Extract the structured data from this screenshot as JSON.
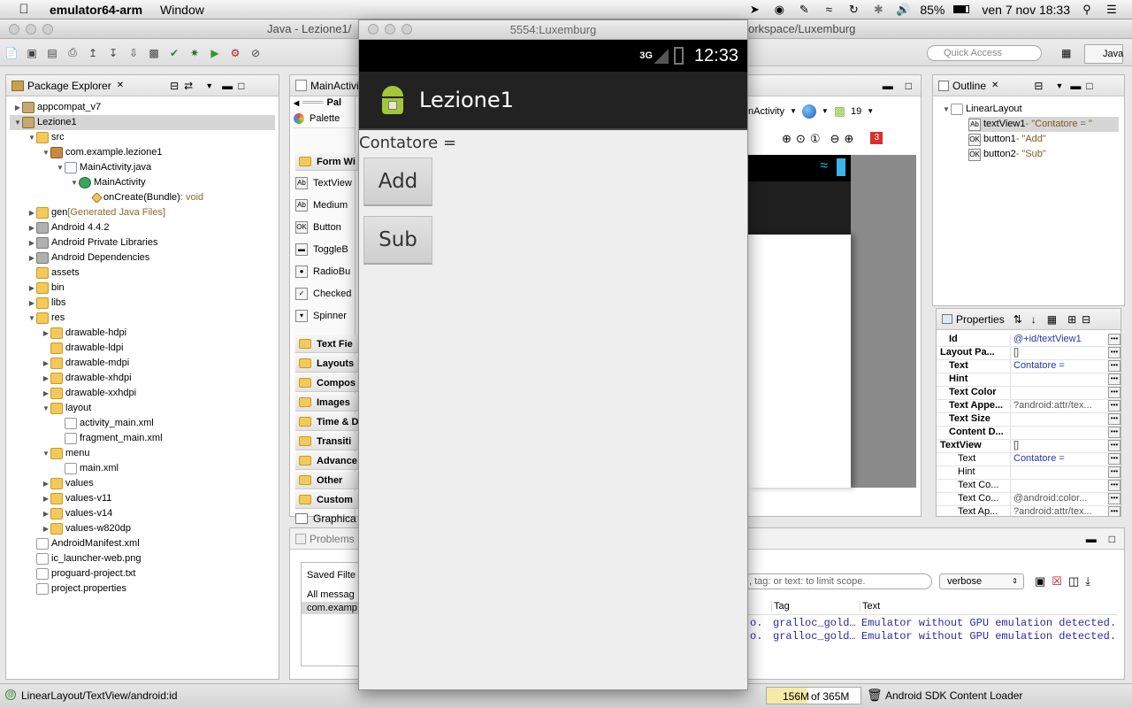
{
  "menubar": {
    "app_name": "emulator64-arm",
    "window_menu": "Window",
    "battery": "85%",
    "datetime": "ven 7 nov  18:33"
  },
  "eclipse": {
    "title": "Java - Lezione1/",
    "title_right": "orkspace/Luxemburg",
    "quick_access_placeholder": "Quick Access",
    "perspective": "Java",
    "status_path": "LinearLayout/TextView/android:id",
    "heap_used": "156M",
    "heap_total": "of 365M",
    "loader": "Android SDK Content Loader"
  },
  "package_explorer": {
    "tab": "Package Explorer",
    "rows": [
      {
        "label": "appcompat_v7",
        "suffix": ""
      },
      {
        "label": "Lezione1",
        "suffix": ""
      },
      {
        "label": "src",
        "suffix": ""
      },
      {
        "label": "com.example.lezione1",
        "suffix": ""
      },
      {
        "label": "MainActivity.java",
        "suffix": ""
      },
      {
        "label": "MainActivity",
        "suffix": ""
      },
      {
        "label": "onCreate(Bundle)",
        "suffix": " : void"
      },
      {
        "label": "gen",
        "suffix": " [Generated Java Files]"
      },
      {
        "label": "Android 4.4.2",
        "suffix": ""
      },
      {
        "label": "Android Private Libraries",
        "suffix": ""
      },
      {
        "label": "Android Dependencies",
        "suffix": ""
      },
      {
        "label": "assets",
        "suffix": ""
      },
      {
        "label": "bin",
        "suffix": ""
      },
      {
        "label": "libs",
        "suffix": ""
      },
      {
        "label": "res",
        "suffix": ""
      },
      {
        "label": "drawable-hdpi",
        "suffix": ""
      },
      {
        "label": "drawable-ldpi",
        "suffix": ""
      },
      {
        "label": "drawable-mdpi",
        "suffix": ""
      },
      {
        "label": "drawable-xhdpi",
        "suffix": ""
      },
      {
        "label": "drawable-xxhdpi",
        "suffix": ""
      },
      {
        "label": "layout",
        "suffix": ""
      },
      {
        "label": "activity_main.xml",
        "suffix": ""
      },
      {
        "label": "fragment_main.xml",
        "suffix": ""
      },
      {
        "label": "menu",
        "suffix": ""
      },
      {
        "label": "main.xml",
        "suffix": ""
      },
      {
        "label": "values",
        "suffix": ""
      },
      {
        "label": "values-v11",
        "suffix": ""
      },
      {
        "label": "values-v14",
        "suffix": ""
      },
      {
        "label": "values-w820dp",
        "suffix": ""
      },
      {
        "label": "AndroidManifest.xml",
        "suffix": ""
      },
      {
        "label": "ic_launcher-web.png",
        "suffix": ""
      },
      {
        "label": "proguard-project.txt",
        "suffix": ""
      },
      {
        "label": "project.properties",
        "suffix": ""
      }
    ]
  },
  "editor": {
    "tab": "MainActivi",
    "palette_tab": "Pal",
    "palette_label": "Palette",
    "form_widgets": "Form Wi",
    "widgets": [
      "TextView",
      "Medium",
      "Button",
      "ToggleB",
      "RadioBu",
      "Checked",
      "Spinner"
    ],
    "groups": [
      "Text Fie",
      "Layouts",
      "Compos",
      "Images",
      "Time & D",
      "Transiti",
      "Advance",
      "Other",
      "Custom"
    ],
    "graphical_tab": "Graphica",
    "config_activity": "nActivity",
    "api_level": "19",
    "error_count": "3"
  },
  "outline": {
    "tab": "Outline",
    "root": "LinearLayout",
    "items": [
      {
        "id": "textView1",
        "desc": " - \"Contatore = \""
      },
      {
        "id": "button1",
        "desc": " - \"Add\""
      },
      {
        "id": "button2",
        "desc": " - \"Sub\""
      }
    ]
  },
  "properties": {
    "tab": "Properties",
    "rows": [
      {
        "k": "Id",
        "v": "@+id/textView1"
      },
      {
        "k": "Layout Pa...",
        "v": "[]"
      },
      {
        "k": "Text",
        "v": "Contatore ="
      },
      {
        "k": "Hint",
        "v": ""
      },
      {
        "k": "Text Color",
        "v": ""
      },
      {
        "k": "Text Appe...",
        "v": "?android:attr/tex..."
      },
      {
        "k": "Text Size",
        "v": ""
      },
      {
        "k": "Content D...",
        "v": ""
      },
      {
        "k": "TextView",
        "v": "[]"
      },
      {
        "k": "Text",
        "v": "Contatore ="
      },
      {
        "k": "Hint",
        "v": ""
      },
      {
        "k": "Text Co...",
        "v": ""
      },
      {
        "k": "Text Co...",
        "v": "@android:color..."
      },
      {
        "k": "Text Ap...",
        "v": "?android:attr/tex..."
      }
    ]
  },
  "bottom": {
    "problems_tab": "Problems",
    "saved_filters": "Saved Filte",
    "all_messages": "All messag",
    "filter_item": "com.examp",
    "search_placeholder": ", tag: or text: to limit scope.",
    "level": "verbose",
    "col_tag": "Tag",
    "col_text": "Text",
    "log_rows": [
      {
        "pre": "o.",
        "tag": "gralloc_gold…",
        "text": "Emulator without GPU emulation detected."
      },
      {
        "pre": "o.",
        "tag": "gralloc_gold…",
        "text": "Emulator without GPU emulation detected."
      }
    ]
  },
  "emulator": {
    "window_title": "5554:Luxemburg",
    "network": "3G",
    "clock": "12:33",
    "app_title": "Lezione1",
    "counter_text": "Contatore =",
    "add_button": "Add",
    "sub_button": "Sub"
  }
}
